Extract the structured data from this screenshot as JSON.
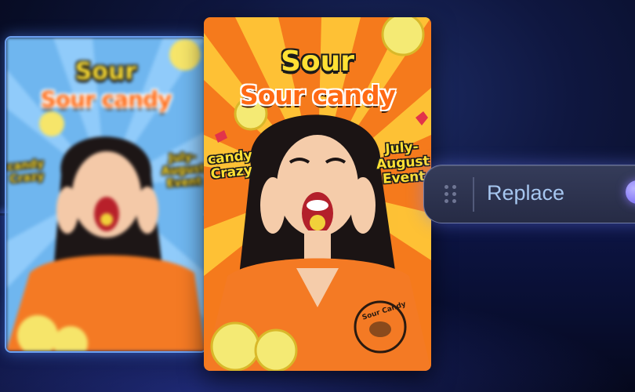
{
  "posters": {
    "front": {
      "headline_top": "Sour",
      "headline_bottom": "Sour candy",
      "side_left": [
        "candy",
        "Crazy"
      ],
      "side_right": [
        "July-",
        "August",
        "Event"
      ],
      "stamp_text": "Sour Candy"
    },
    "back": {
      "headline_top": "Sour",
      "headline_bottom": "Sour candy",
      "side_left": [
        "candy",
        "Crazy"
      ],
      "side_right": [
        "July-",
        "August",
        "Event"
      ]
    }
  },
  "action_pill": {
    "label": "Replace",
    "handle_icon": "drag-handle-icon"
  },
  "colors": {
    "background": "#0b1233",
    "front_poster_bg": "#f57a1c",
    "back_poster_bg": "#6fb6ef",
    "headline_yellow": "#ffe033",
    "headline_orange": "#ff6a14",
    "pill_bg": "#2c3250",
    "pill_text": "#a6c6ef",
    "accent_glow": "#6e8cff"
  }
}
